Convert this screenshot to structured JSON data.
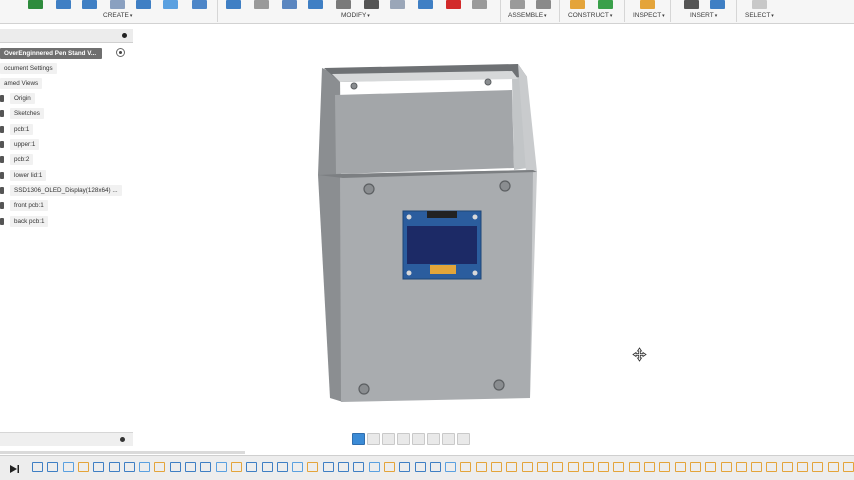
{
  "toolbar": {
    "groups": [
      {
        "label": "CREATE"
      },
      {
        "label": "MODIFY"
      },
      {
        "label": "ASSEMBLE"
      },
      {
        "label": "CONSTRUCT"
      },
      {
        "label": "INSPECT"
      },
      {
        "label": "INSERT"
      },
      {
        "label": "SELECT"
      }
    ],
    "caret": "▾"
  },
  "browser": {
    "root": "OverEnginnered Pen Stand V...",
    "items": [
      {
        "label": "ocument Settings"
      },
      {
        "label": "amed Views"
      },
      {
        "label": "Origin"
      },
      {
        "label": "Sketches"
      },
      {
        "label": "pcb:1"
      },
      {
        "label": "upper:1"
      },
      {
        "label": "pcb:2"
      },
      {
        "label": "lower lid:1"
      },
      {
        "label": "SSD1306_OLED_Display(128x64) ..."
      },
      {
        "label": "front pcb:1"
      },
      {
        "label": "back pcb:1"
      }
    ]
  },
  "icons": {
    "move_cursor": "move-cursor-icon",
    "play": "play-icon",
    "pin": "pin-icon"
  },
  "colors": {
    "toolbar_bg": "#f6f6f6",
    "root_bg": "#6f6f6f",
    "box_front": "#a7aaad",
    "box_side": "#8d9093",
    "oled_pcb": "#2b5d9e",
    "oled_screen": "#1c2a66",
    "oled_header": "#e2a53a"
  }
}
